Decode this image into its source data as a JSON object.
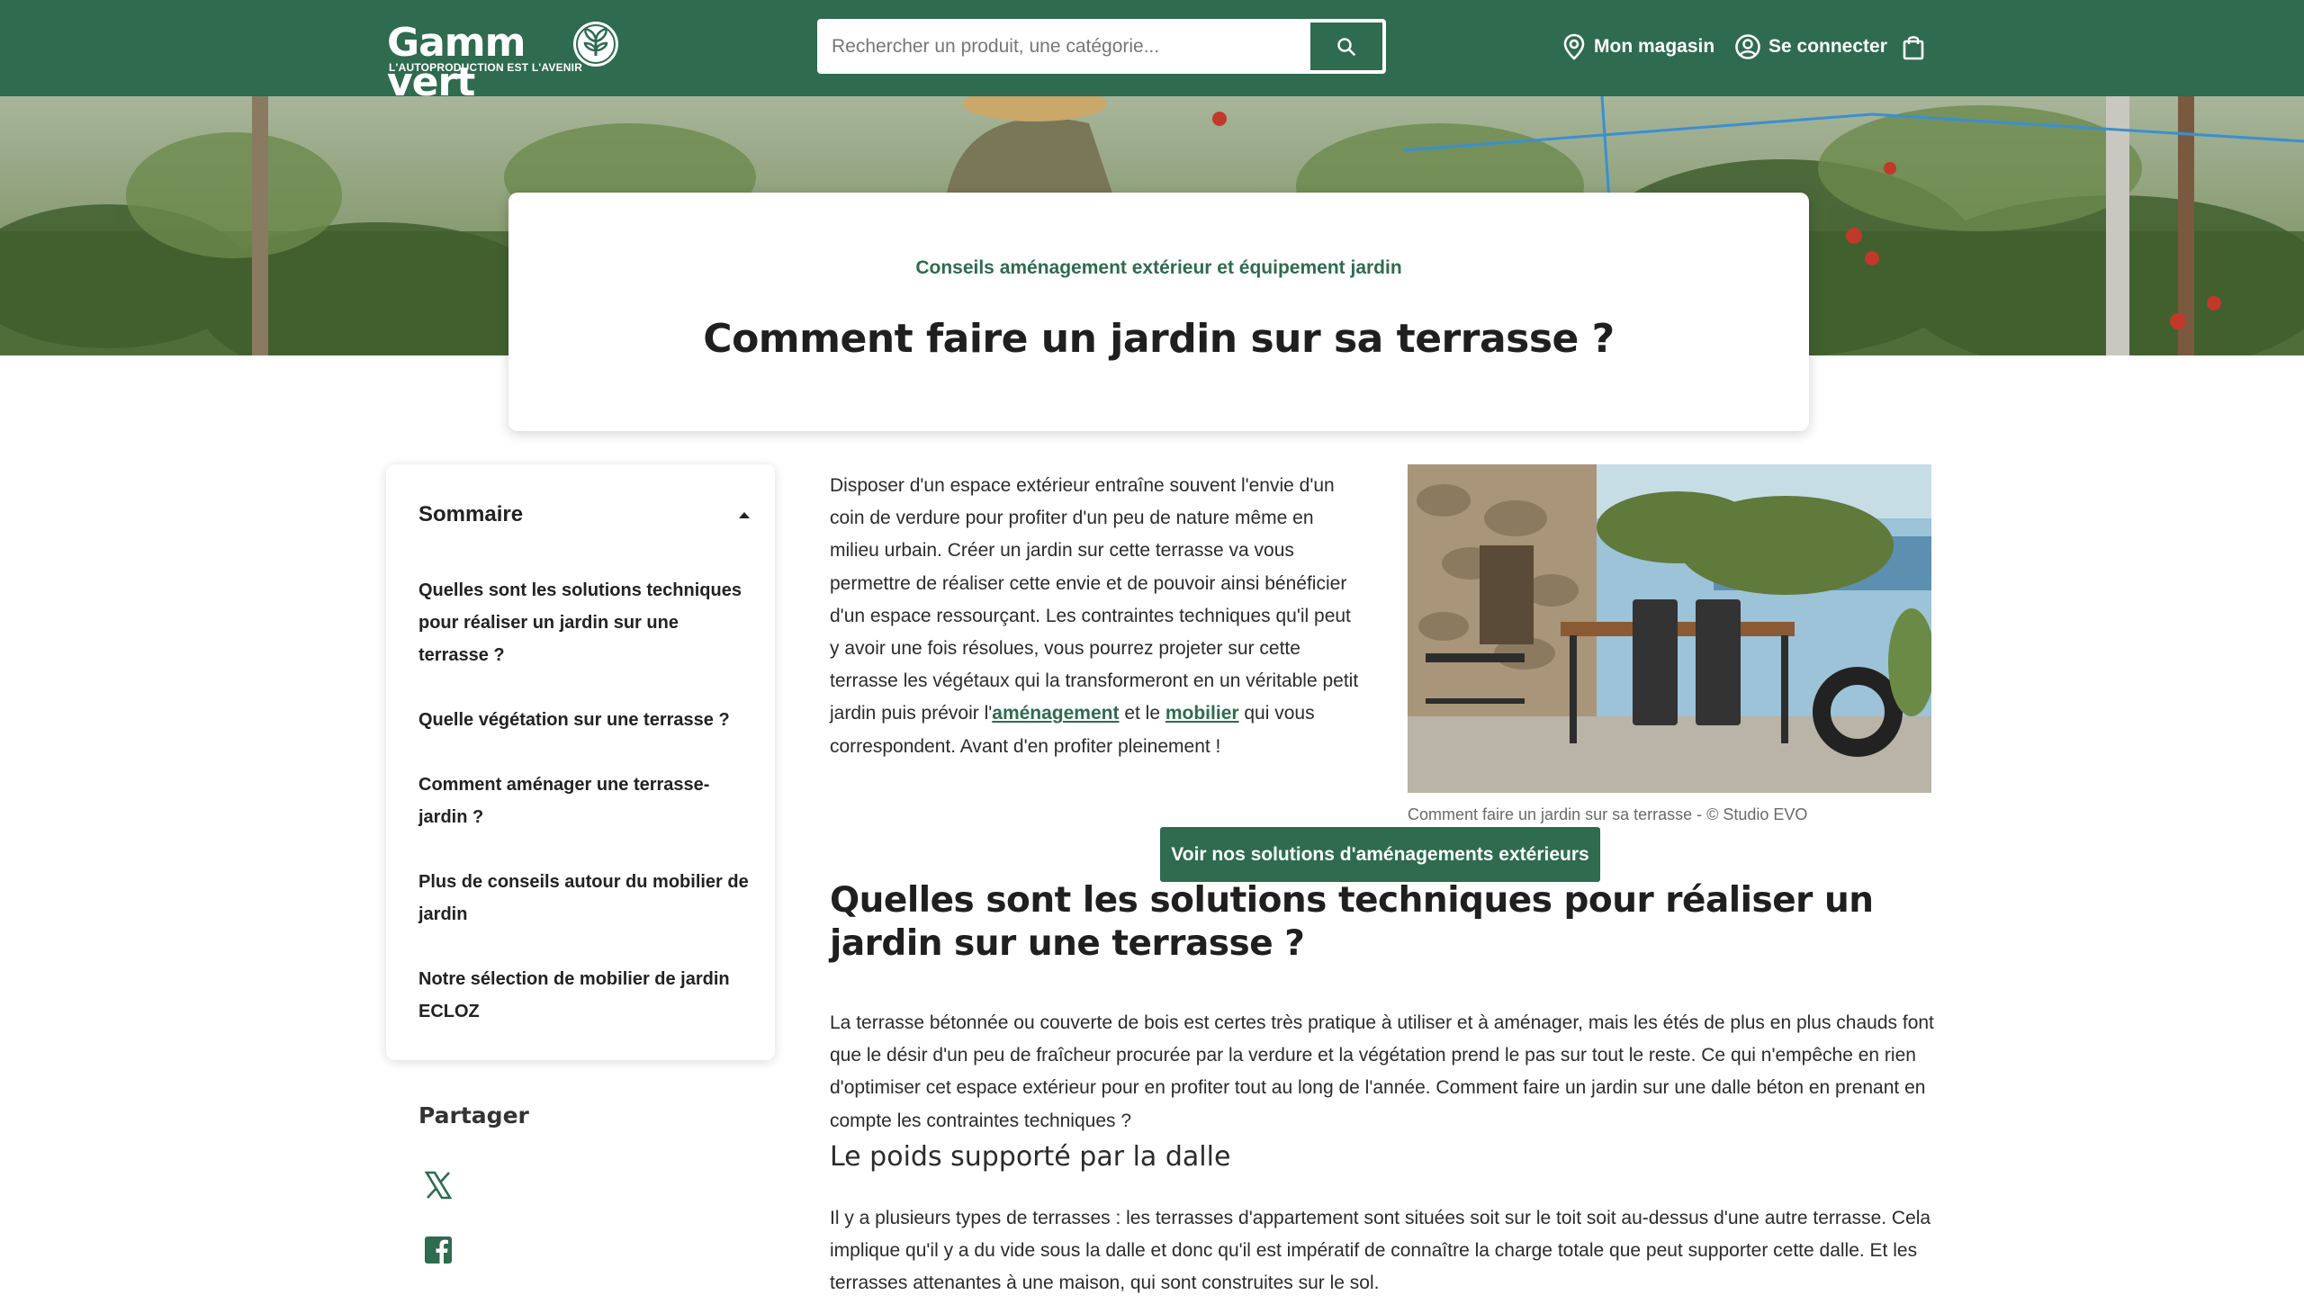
{
  "header": {
    "logo_text": "Gamm vert",
    "logo_tagline": "L'AUTOPRODUCTION EST L'AVENIR",
    "search_placeholder": "Rechercher un produit, une catégorie...",
    "store_label": "Mon magasin",
    "login_label": "Se connecter",
    "icons": {
      "search": "search-icon",
      "store": "location-pin-icon",
      "login": "user-circle-icon",
      "cart": "shopping-bag-icon"
    }
  },
  "hero": {
    "category": "Conseils aménagement extérieur et équipement jardin",
    "title": "Comment faire un jardin sur sa terrasse ?"
  },
  "toc": {
    "title": "Sommaire",
    "items": [
      {
        "label": "Quelles sont les solutions techniques pour réaliser un jardin sur une terrasse ?"
      },
      {
        "label": "Quelle végétation sur une terrasse ?"
      },
      {
        "label": "Comment aménager une terrasse-jardin ?"
      },
      {
        "label": "Plus de conseils autour du mobilier de jardin"
      },
      {
        "label": "Notre sélection de mobilier de jardin ECLOZ"
      }
    ]
  },
  "share": {
    "title": "Partager",
    "icons": [
      "x-icon",
      "facebook-icon"
    ]
  },
  "article": {
    "intro_part1": "Disposer d'un espace extérieur entraîne souvent l'envie d'un coin de verdure pour profiter d'un peu de nature même en milieu urbain. Créer un jardin sur cette terrasse va vous permettre de réaliser cette envie et de pouvoir ainsi bénéficier d'un espace ressourçant. Les contraintes techniques qu'il peut y avoir une fois résolues, vous pourrez projeter sur cette terrasse les végétaux qui la transformeront en un véritable petit jardin puis prévoir l'",
    "link_amenagement": "aménagement",
    "intro_part2": " et le ",
    "link_mobilier": "mobilier",
    "intro_part3": " qui vous correspondent. Avant d'en profiter pleinement !",
    "image_caption": "Comment faire un jardin sur sa terrasse - © Studio EVO",
    "cta_label": "Voir nos solutions d'aménagements extérieurs",
    "section1_title": "Quelles sont les solutions techniques pour réaliser un jardin sur une terrasse ?",
    "section1_text": "La terrasse bétonnée ou couverte de bois est certes très pratique à utiliser et à aménager, mais les étés de plus en plus chauds font que le désir d'un peu de fraîcheur procurée par la verdure et la végétation prend le pas sur tout le reste. Ce qui n'empêche en rien d'optimiser cet espace extérieur pour en profiter tout au long de l'année. Comment faire un jardin sur une dalle béton en prenant en compte les contraintes techniques ?",
    "subsection_title": "Le poids supporté par la dalle",
    "subsection_text": "Il y a plusieurs types de terrasses : les terrasses d'appartement sont situées soit sur le toit soit au-dessus d'une autre terrasse. Cela implique qu'il y a du vide sous la dalle et donc qu'il est impératif de connaître la charge totale que peut supporter cette dalle. Et les terrasses attenantes à une maison, qui sont construites sur le sol."
  },
  "colors": {
    "brand_green": "#2e6b4f",
    "text": "#2b2b2b",
    "caption": "#6a6a6a"
  }
}
